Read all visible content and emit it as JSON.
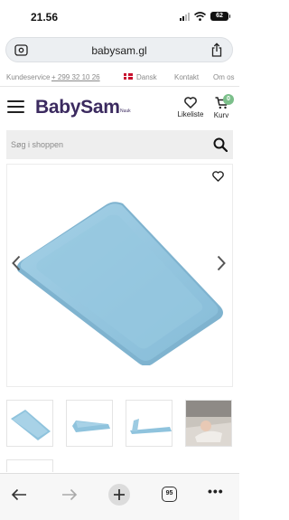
{
  "status_bar": {
    "time": "21.56",
    "battery": "62"
  },
  "browser": {
    "url": "babysam.gl"
  },
  "utility_bar": {
    "customer_service": "Kundeservice",
    "phone": "+ 299 32 10 26",
    "language": "Dansk",
    "contact": "Kontakt",
    "about": "Om os"
  },
  "header": {
    "logo": "BabySam",
    "logo_subtext": "Nuuk",
    "wishlist_label": "Likeliste",
    "cart_label": "Kurv",
    "cart_count": "0"
  },
  "search": {
    "placeholder": "Søg i shoppen"
  },
  "toolbar": {
    "tab_count": "95"
  },
  "colors": {
    "brand": "#3b2a5f",
    "cart_badge": "#7bbf8a",
    "product": "#8fc3dd",
    "flag": "#c8102e"
  },
  "icons": [
    "signal-icon",
    "wifi-icon",
    "battery-icon",
    "tab-settings-icon",
    "share-icon",
    "flag-icon",
    "menu-icon",
    "heart-icon",
    "cart-icon",
    "search-icon",
    "chevron-left-icon",
    "chevron-right-icon",
    "back-icon",
    "forward-icon",
    "plus-icon",
    "tabs-icon",
    "more-icon"
  ]
}
